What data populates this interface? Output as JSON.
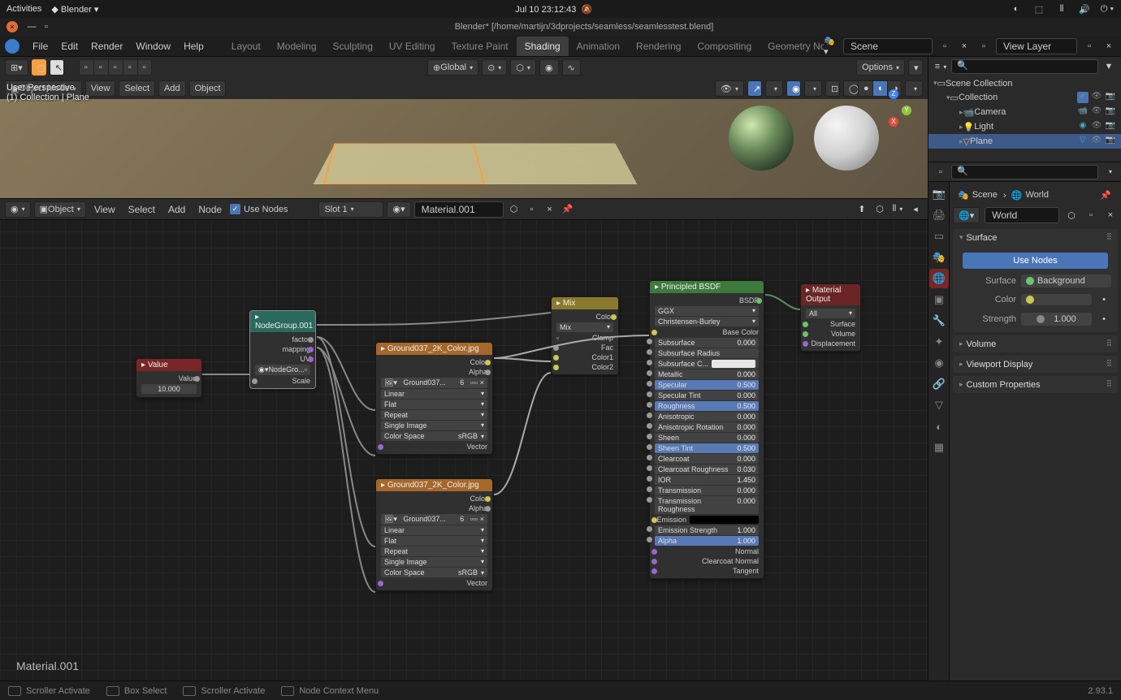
{
  "desktop": {
    "activities": "Activities",
    "app": "Blender",
    "datetime": "Jul 10  23:12:43"
  },
  "window": {
    "title": "Blender* [/home/martijn/3dprojects/seamless/seamlesstest.blend]"
  },
  "menubar": {
    "file": "File",
    "edit": "Edit",
    "render": "Render",
    "window": "Window",
    "help": "Help"
  },
  "workspaces": {
    "layout": "Layout",
    "modeling": "Modeling",
    "sculpting": "Sculpting",
    "uv": "UV Editing",
    "texture": "Texture Paint",
    "shading": "Shading",
    "animation": "Animation",
    "rendering": "Rendering",
    "compositing": "Compositing",
    "geometry": "Geometry No"
  },
  "header_right": {
    "scene": "Scene",
    "viewlayer": "View Layer"
  },
  "viewport3d": {
    "mode": "Object Mode",
    "menus": {
      "view": "View",
      "select": "Select",
      "add": "Add",
      "object": "Object"
    },
    "transform": "Global",
    "options": "Options",
    "overlay": {
      "persp": "User Perspective",
      "collection": "(1) Collection | Plane"
    }
  },
  "node_editor": {
    "object": "Object",
    "menus": {
      "view": "View",
      "select": "Select",
      "add": "Add",
      "node": "Node"
    },
    "use_nodes": "Use Nodes",
    "slot": "Slot 1",
    "material": "Material.001",
    "overlay_mat": "Material.001"
  },
  "nodes": {
    "value": {
      "title": "Value",
      "out": "Value",
      "val": "10.000"
    },
    "nodegroup": {
      "title": "NodeGroup.001",
      "factor": "factor",
      "mapping": "mapping",
      "uv": "UV",
      "link": "NodeGro...",
      "scale": "Scale"
    },
    "img1": {
      "title": "Ground037_2K_Color.jpg",
      "out_color": "Color",
      "out_alpha": "Alpha",
      "file": "Ground037...",
      "users": "6",
      "interp": "Linear",
      "proj": "Flat",
      "ext": "Repeat",
      "single": "Single Image",
      "cspace_lbl": "Color Space",
      "cspace": "sRGB",
      "vector": "Vector"
    },
    "img2": {
      "title": "Ground037_2K_Color.jpg",
      "out_color": "Color",
      "out_alpha": "Alpha",
      "file": "Ground037...",
      "users": "6",
      "interp": "Linear",
      "proj": "Flat",
      "ext": "Repeat",
      "single": "Single Image",
      "cspace_lbl": "Color Space",
      "cspace": "sRGB",
      "vector": "Vector"
    },
    "mix": {
      "title": "Mix",
      "out": "Color",
      "blend": "Mix",
      "clamp": "Clamp",
      "fac": "Fac",
      "color1": "Color1",
      "color2": "Color2"
    },
    "bsdf": {
      "title": "Principled BSDF",
      "out": "BSDF",
      "dist": "GGX",
      "sss": "Christensen-Burley",
      "base_color": "Base Color",
      "rows": [
        {
          "label": "Subsurface",
          "val": "0.000",
          "blue": false
        },
        {
          "label": "Subsurface Radius",
          "val": "",
          "blue": false
        },
        {
          "label": "Subsurface C...",
          "val": "",
          "blue": false,
          "white": true
        },
        {
          "label": "Metallic",
          "val": "0.000",
          "blue": false
        },
        {
          "label": "Specular",
          "val": "0.500",
          "blue": true
        },
        {
          "label": "Specular Tint",
          "val": "0.000",
          "blue": false
        },
        {
          "label": "Roughness",
          "val": "0.500",
          "blue": true
        },
        {
          "label": "Anisotropic",
          "val": "0.000",
          "blue": false
        },
        {
          "label": "Anisotropic Rotation",
          "val": "0.000",
          "blue": false
        },
        {
          "label": "Sheen",
          "val": "0.000",
          "blue": false
        },
        {
          "label": "Sheen Tint",
          "val": "0.500",
          "blue": true
        },
        {
          "label": "Clearcoat",
          "val": "0.000",
          "blue": false
        },
        {
          "label": "Clearcoat Roughness",
          "val": "0.030",
          "blue": false
        },
        {
          "label": "IOR",
          "val": "1.450",
          "blue": false
        },
        {
          "label": "Transmission",
          "val": "0.000",
          "blue": false
        },
        {
          "label": "Transmission Roughness",
          "val": "0.000",
          "blue": false
        }
      ],
      "emission": "Emission",
      "emission_strength": {
        "label": "Emission Strength",
        "val": "1.000"
      },
      "alpha": {
        "label": "Alpha",
        "val": "1.000"
      },
      "normal": "Normal",
      "clearcoat_normal": "Clearcoat Normal",
      "tangent": "Tangent"
    },
    "output": {
      "title": "Material Output",
      "target": "All",
      "surface": "Surface",
      "volume": "Volume",
      "displacement": "Displacement"
    }
  },
  "outliner": {
    "scene_collection": "Scene Collection",
    "collection": "Collection",
    "camera": "Camera",
    "light": "Light",
    "plane": "Plane"
  },
  "props": {
    "breadcrumb_scene": "Scene",
    "breadcrumb_world": "World",
    "world": "World",
    "surface_panel": "Surface",
    "use_nodes_btn": "Use Nodes",
    "surface_lbl": "Surface",
    "surface_val": "Background",
    "color_lbl": "Color",
    "strength_lbl": "Strength",
    "strength_val": "1.000",
    "volume": "Volume",
    "viewport_display": "Viewport Display",
    "custom_props": "Custom Properties"
  },
  "statusbar": {
    "scroller": "Scroller Activate",
    "box_select": "Box Select",
    "scroller2": "Scroller Activate",
    "context": "Node Context Menu",
    "version": "2.93.1"
  }
}
